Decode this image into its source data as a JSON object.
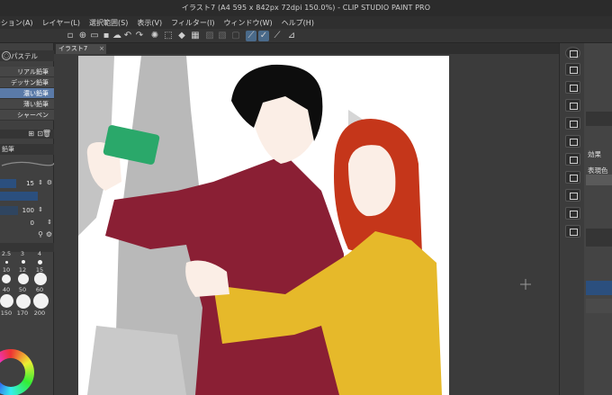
{
  "window": {
    "title": "イラスト7 (A4 595 x 842px 72dpi 150.0%) - CLIP STUDIO PAINT PRO"
  },
  "menu": [
    "ーション(A)",
    "レイヤー(L)",
    "選択範囲(S)",
    "表示(V)",
    "フィルター(I)",
    "ウィンドウ(W)",
    "ヘルプ(H)"
  ],
  "canvas_tab": {
    "label": "イラスト7",
    "close": "×"
  },
  "subtool": {
    "group_label": "パステル",
    "brushes": [
      "リアル鉛筆",
      "デッサン鉛筆",
      "濃い鉛筆",
      "薄い鉛筆",
      "シャーペン"
    ],
    "active_index": 2
  },
  "tool_property": {
    "label": "鉛筆",
    "size_value": "15",
    "opacity_value": "100",
    "third_value": "0"
  },
  "brush_sizes": [
    "2.5",
    "3",
    "4",
    "10",
    "12",
    "15",
    "40",
    "50",
    "60",
    "150",
    "170",
    "200"
  ],
  "right_panel": {
    "effect_label": "効果",
    "expression_label": "表現色"
  },
  "colors": {
    "accent": "#5a7aa8",
    "panel": "#404040",
    "sweater_red": "#8a1f34",
    "sweater_yellow": "#e6b92a",
    "phone_green": "#2aa86a",
    "hair_red": "#c5361a"
  }
}
